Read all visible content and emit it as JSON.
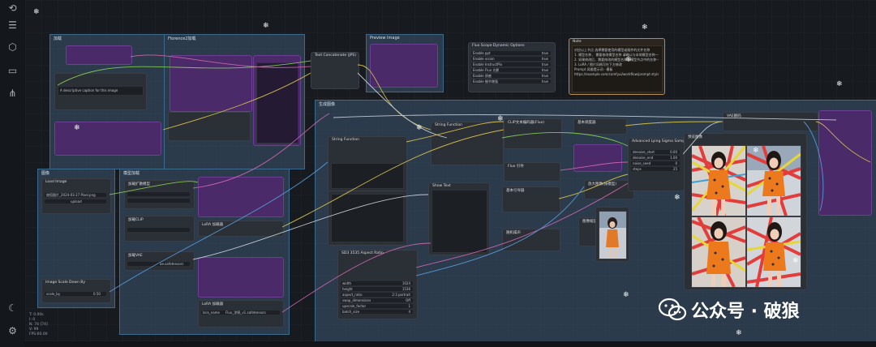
{
  "sidebar": {
    "items": [
      {
        "name": "history-icon",
        "glyph": "⟲"
      },
      {
        "name": "queue-icon",
        "glyph": "☰"
      },
      {
        "name": "node-library-icon",
        "glyph": "⬡"
      },
      {
        "name": "workflows-icon",
        "glyph": "▭"
      },
      {
        "name": "model-library-icon",
        "glyph": "⋔"
      }
    ],
    "theme_glyph": "☾",
    "settings_glyph": "⚙"
  },
  "groups": {
    "top_left": "加载",
    "top_mid": "Florence2加载",
    "top_right": "Florence2加载",
    "bottom_left": "图像",
    "bottom_mid": "模型加载",
    "main": "生成图像"
  },
  "nodes": {
    "text_concat": "Text Concatenate (JPS)",
    "preview_image": "Preview Image",
    "note_title": "Note",
    "note_lines": [
      "对应以上节点 选择需要使用的模型或插件的文件名称",
      "1. 模型名称， 需要修改模型名称 请确认与本地模型名称一致",
      "2. 如果修改后，需要修改的模型名称与模型节点中的名称一致",
      "3. LoRA / 图片风格可在下方修改",
      "Prompt 风格提示词 · 模板",
      "https://example.com/comfyui/workflow/prompt-styles"
    ],
    "style_selector": "Flux Scope Dynamic Options",
    "style_rows": [
      {
        "label": "Enable ppt",
        "val": "true"
      },
      {
        "label": "Enable vision",
        "val": "true"
      },
      {
        "label": "Enable InstructPix",
        "val": "true"
      },
      {
        "label": "Enable Flux 光影",
        "val": "true"
      },
      {
        "label": "Enable 质感",
        "val": "true"
      },
      {
        "label": "Enable 细节增强",
        "val": "true"
      }
    ],
    "load_image": "Load Image",
    "image_file": "穿搭图片_2024-03-27 Pixel.png",
    "upload": "upload",
    "image_scale": "Image Scale Down By",
    "scale_label": "scale_by",
    "scale_val": "0.50",
    "prompt_caption": "A descriptive caption for this image",
    "lora_loader": "LoRA 加载器",
    "lora_name": "lora_name",
    "lora_file": "Flux_涂鸦_v1.safetensors",
    "unet_loader": "加载扩散模型",
    "clip_loader": "加载CLIP",
    "vae_loader": "加载VAE",
    "vae_file": "ae.safetensors",
    "string_function": "String Function",
    "clip_text_encode": "CLIP文本编码器(Flux)",
    "basic_scheduler": "基本调度器",
    "ksampler": "Advanced Lying Sigma Sampler",
    "sampler_rows": [
      {
        "label": "denoise_start",
        "val": "0.00"
      },
      {
        "label": "denoise_end",
        "val": "1.00"
      },
      {
        "label": "noise_seed",
        "val": "0"
      },
      {
        "label": "steps",
        "val": "25"
      }
    ],
    "preview_out": "预览图像",
    "vae_decode": "VAE解码",
    "empty_latent": "SD3 3535 Aspect Ratio",
    "latent_rows": [
      {
        "label": "width",
        "val": "1024"
      },
      {
        "label": "height",
        "val": "1536"
      },
      {
        "label": "aspect_ratio",
        "val": "2:3 portrait"
      },
      {
        "label": "swap_dimensions",
        "val": "Off"
      },
      {
        "label": "upscale_factor",
        "val": "1"
      },
      {
        "label": "batch_size",
        "val": "4"
      }
    ],
    "show_text": "Show Text",
    "random_noise": "随机噪声",
    "guider": "基本引导器",
    "flux_guidance": "Flux 引导",
    "resize": "图像缩放",
    "upscale": "放大图像(按模型)"
  },
  "status": {
    "lines": [
      "T: 0.00s",
      "I: 0",
      "N: 74 [74]",
      "V: 99",
      "FPS:60.00"
    ]
  },
  "watermark": {
    "text": "公众号 · 破狼"
  },
  "colors": {
    "group": "#3c6a8c",
    "purple_node": "#4a2a68",
    "wire_green": "#8bd45a",
    "wire_pink": "#d46ab4",
    "wire_yellow": "#e0c84a",
    "wire_blue": "#5aa2e0",
    "wire_white": "#cfd6de",
    "note_border": "#b88a48"
  }
}
